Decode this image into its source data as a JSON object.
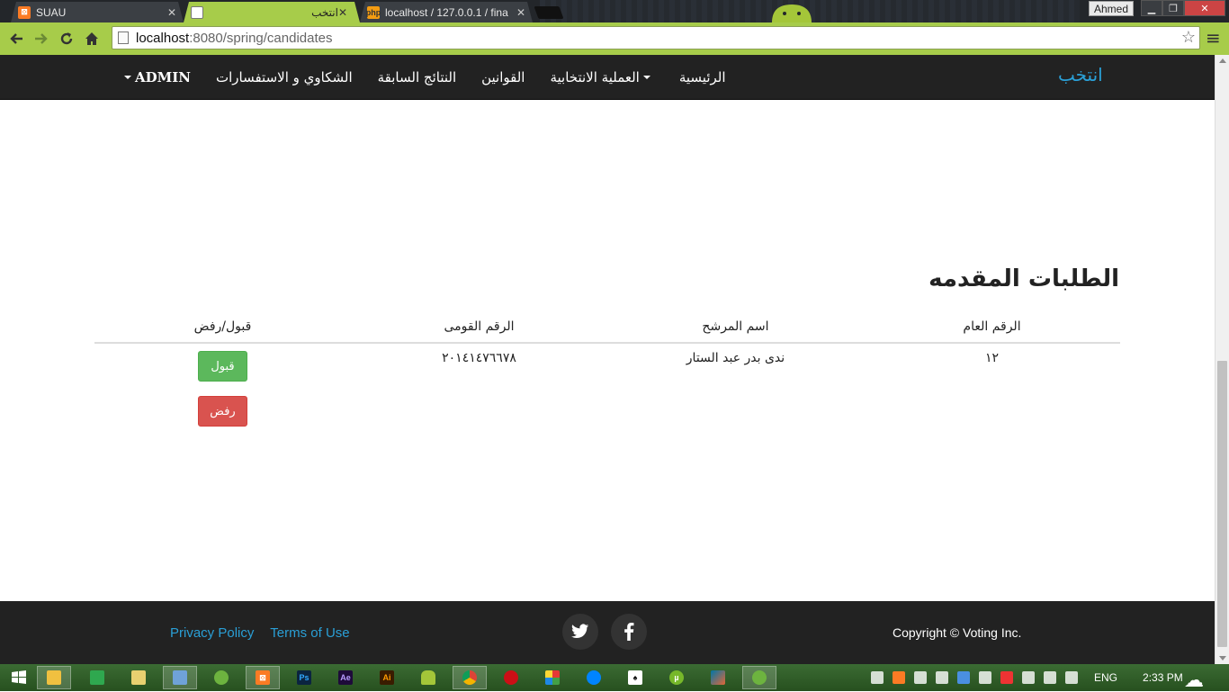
{
  "browser": {
    "tabs": [
      {
        "title": "SUAU",
        "active": false
      },
      {
        "title": "انتخب",
        "active": true
      },
      {
        "title": "localhost / 127.0.0.1 / fina",
        "active": false
      }
    ],
    "user": "Ahmed",
    "url_host": "localhost",
    "url_path": ":8080/spring/candidates",
    "window_controls": {
      "minimize": "▁",
      "restore": "❐",
      "close": "✕"
    }
  },
  "navbar": {
    "brand": "انتخب",
    "links": [
      "الرئيسية",
      "العملية الانتخابية",
      "القوانين",
      "النتائج السابقة",
      "الشكاوي و الاستفسارات",
      "ADMIN"
    ]
  },
  "main": {
    "heading": "الطلبات المقدمه",
    "table": {
      "headers": [
        "الرقم العام",
        "اسم المرشح",
        "الرقم القومى",
        "قبول/رفض"
      ],
      "rows": [
        {
          "id": "١٢",
          "name": "ندى بدر عبد الستار",
          "national_id": "٢٠١٤١٤٧٦٦٧٨"
        }
      ]
    },
    "accept_label": "قبول",
    "reject_label": "رفض"
  },
  "footer": {
    "privacy": "Privacy Policy",
    "terms": "Terms of Use",
    "copyright": "Copyright © Voting Inc."
  },
  "taskbar": {
    "language": "ENG",
    "time": "2:33 PM"
  },
  "colors": {
    "accent": "#2a9fd6",
    "success": "#5cb85c",
    "danger": "#d9534f",
    "chrome_theme": "#a7cc4a"
  }
}
